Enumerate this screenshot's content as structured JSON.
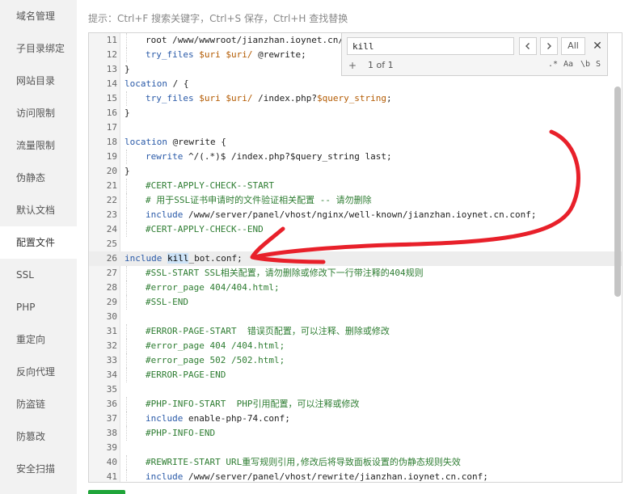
{
  "sidebar": {
    "items": [
      {
        "label": "域名管理"
      },
      {
        "label": "子目录绑定"
      },
      {
        "label": "网站目录"
      },
      {
        "label": "访问限制"
      },
      {
        "label": "流量限制"
      },
      {
        "label": "伪静态"
      },
      {
        "label": "默认文档"
      },
      {
        "label": "配置文件"
      },
      {
        "label": "SSL"
      },
      {
        "label": "PHP"
      },
      {
        "label": "重定向"
      },
      {
        "label": "反向代理"
      },
      {
        "label": "防盗链"
      },
      {
        "label": "防篡改"
      },
      {
        "label": "安全扫描"
      }
    ],
    "active_index": 7
  },
  "hint": "提示：Ctrl+F 搜索关键字，Ctrl+S 保存，Ctrl+H 查找替换",
  "search": {
    "query": "kill",
    "prev_icon": "chevron-left-icon",
    "next_icon": "chevron-right-icon",
    "all_label": "All",
    "close_label": "✕",
    "add_label": "+",
    "count_text": "1 of 1",
    "opt_regex": ".*",
    "opt_case": "Aa",
    "opt_word": "\\b",
    "opt_selection": "S"
  },
  "editor": {
    "current_line": 26,
    "lines": [
      {
        "n": "11",
        "indent": true,
        "tokens": [
          [
            "pl",
            "root /www/wwwroot/jianzhan.ioynet.cn/"
          ]
        ]
      },
      {
        "n": "12",
        "indent": true,
        "tokens": [
          [
            "kw",
            "try_files "
          ],
          [
            "var",
            "$uri $uri/"
          ],
          [
            "pl",
            " @rewrite;"
          ]
        ]
      },
      {
        "n": "13",
        "indent": false,
        "tokens": [
          [
            "pl",
            "}"
          ]
        ]
      },
      {
        "n": "14",
        "indent": false,
        "tokens": [
          [
            "kw",
            "location"
          ],
          [
            "pl",
            " / {"
          ]
        ]
      },
      {
        "n": "15",
        "indent": true,
        "tokens": [
          [
            "kw",
            "try_files "
          ],
          [
            "var",
            "$uri $uri/"
          ],
          [
            "pl",
            " /index.php?"
          ],
          [
            "var",
            "$query_string"
          ],
          [
            "pl",
            ";"
          ]
        ]
      },
      {
        "n": "16",
        "indent": false,
        "tokens": [
          [
            "pl",
            "}"
          ]
        ]
      },
      {
        "n": "17",
        "indent": false,
        "tokens": []
      },
      {
        "n": "18",
        "indent": false,
        "tokens": [
          [
            "kw",
            "location"
          ],
          [
            "pl",
            " @rewrite {"
          ]
        ]
      },
      {
        "n": "19",
        "indent": true,
        "tokens": [
          [
            "kw",
            "rewrite "
          ],
          [
            "pl",
            "^/(.*)$ /index.php?$query_string last;"
          ]
        ]
      },
      {
        "n": "20",
        "indent": false,
        "tokens": [
          [
            "pl",
            "}"
          ]
        ]
      },
      {
        "n": "21",
        "indent": true,
        "tokens": [
          [
            "cm",
            "#CERT-APPLY-CHECK--START"
          ]
        ]
      },
      {
        "n": "22",
        "indent": true,
        "tokens": [
          [
            "cm",
            "# 用于SSL证书申请时的文件验证相关配置 -- 请勿删除"
          ]
        ]
      },
      {
        "n": "23",
        "indent": true,
        "tokens": [
          [
            "kw",
            "include "
          ],
          [
            "pl",
            "/www/server/panel/vhost/nginx/well-known/jianzhan.ioynet.cn.conf;"
          ]
        ]
      },
      {
        "n": "24",
        "indent": true,
        "tokens": [
          [
            "cm",
            "#CERT-APPLY-CHECK--END"
          ]
        ]
      },
      {
        "n": "25",
        "indent": false,
        "tokens": []
      },
      {
        "n": "26",
        "indent": false,
        "tokens": [
          [
            "kw",
            "include "
          ],
          [
            "sel",
            "kill"
          ],
          [
            "pl",
            "_bot.conf;"
          ]
        ]
      },
      {
        "n": "27",
        "indent": true,
        "tokens": [
          [
            "cm",
            "#SSL-START SSL相关配置，请勿删除或修改下一行带注释的404规则"
          ]
        ]
      },
      {
        "n": "28",
        "indent": true,
        "tokens": [
          [
            "cm",
            "#error_page 404/404.html;"
          ]
        ]
      },
      {
        "n": "29",
        "indent": true,
        "tokens": [
          [
            "cm",
            "#SSL-END"
          ]
        ]
      },
      {
        "n": "30",
        "indent": false,
        "tokens": []
      },
      {
        "n": "31",
        "indent": true,
        "tokens": [
          [
            "cm",
            "#ERROR-PAGE-START  错误页配置，可以注释、删除或修改"
          ]
        ]
      },
      {
        "n": "32",
        "indent": true,
        "tokens": [
          [
            "cm",
            "#error_page 404 /404.html;"
          ]
        ]
      },
      {
        "n": "33",
        "indent": true,
        "tokens": [
          [
            "cm",
            "#error_page 502 /502.html;"
          ]
        ]
      },
      {
        "n": "34",
        "indent": true,
        "tokens": [
          [
            "cm",
            "#ERROR-PAGE-END"
          ]
        ]
      },
      {
        "n": "35",
        "indent": false,
        "tokens": []
      },
      {
        "n": "36",
        "indent": true,
        "tokens": [
          [
            "cm",
            "#PHP-INFO-START  PHP引用配置，可以注释或修改"
          ]
        ]
      },
      {
        "n": "37",
        "indent": true,
        "tokens": [
          [
            "kw",
            "include "
          ],
          [
            "pl",
            "enable-php-74.conf;"
          ]
        ]
      },
      {
        "n": "38",
        "indent": true,
        "tokens": [
          [
            "cm",
            "#PHP-INFO-END"
          ]
        ]
      },
      {
        "n": "39",
        "indent": false,
        "tokens": []
      },
      {
        "n": "40",
        "indent": true,
        "tokens": [
          [
            "cm",
            "#REWRITE-START URL重写规则引用,修改后将导致面板设置的伪静态规则失效"
          ]
        ]
      },
      {
        "n": "41",
        "indent": true,
        "tokens": [
          [
            "kw",
            "include "
          ],
          [
            "pl",
            "/www/server/panel/vhost/rewrite/jianzhan.ioynet.cn.conf;"
          ]
        ]
      }
    ]
  },
  "colors": {
    "annotation_arrow": "#e8202a",
    "keyword": "#2a5aa8",
    "comment": "#2e7d32",
    "variable": "#b35a00",
    "match_highlight": "#cde3f7",
    "save_button": "#20a53a"
  }
}
